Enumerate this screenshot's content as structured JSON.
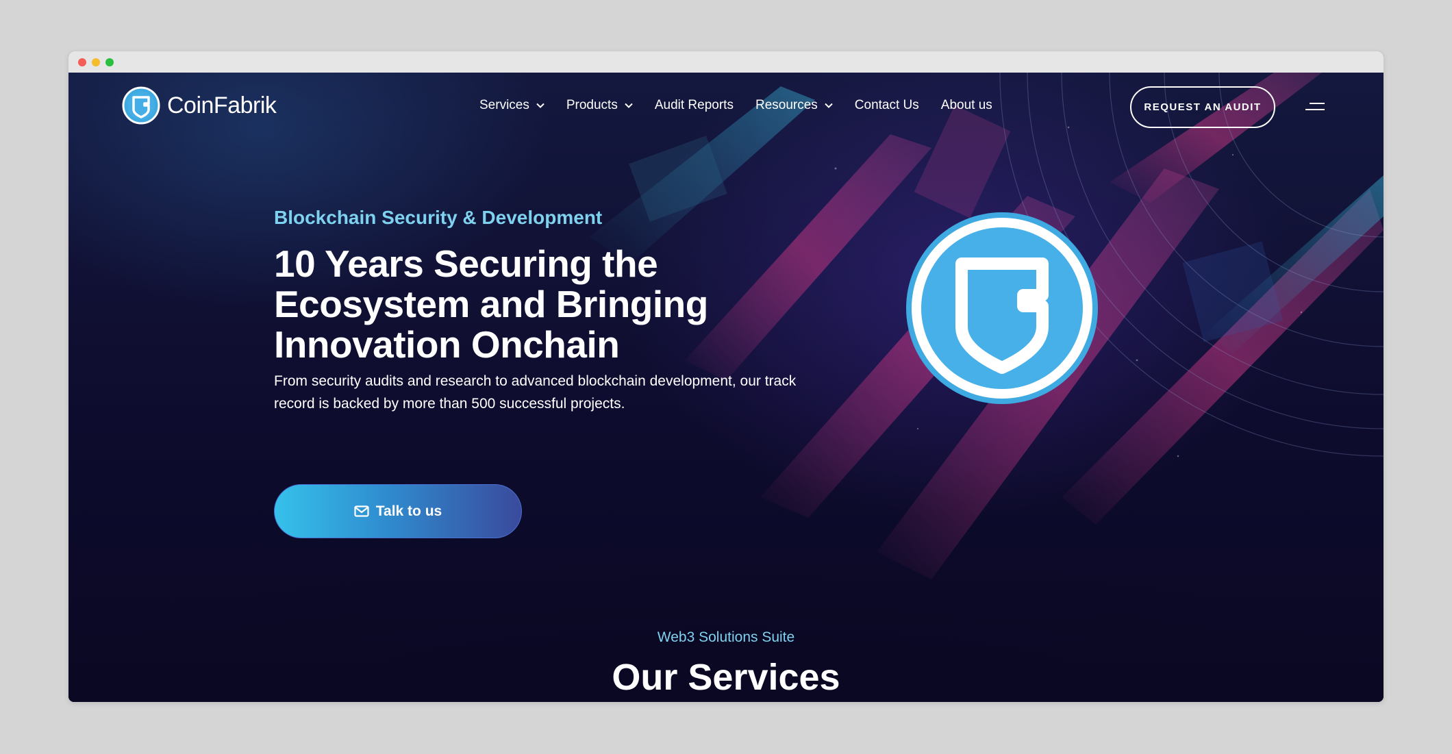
{
  "browser": {
    "title_buttons": [
      "close",
      "minimize",
      "maximize"
    ]
  },
  "header": {
    "logo_text": "CoinFabrik",
    "logo_icon": "shield-logo-icon",
    "nav": [
      {
        "label": "Services",
        "has_dropdown": true
      },
      {
        "label": "Products",
        "has_dropdown": true
      },
      {
        "label": "Audit Reports",
        "has_dropdown": false
      },
      {
        "label": "Resources",
        "has_dropdown": true
      },
      {
        "label": "Contact Us",
        "has_dropdown": false
      },
      {
        "label": "About us",
        "has_dropdown": false
      }
    ],
    "cta_label": "REQUEST AN AUDIT",
    "menu_icon": "hamburger-menu-icon"
  },
  "hero": {
    "eyebrow": "Blockchain Security & Development",
    "title_lines": [
      "10 Years Securing the",
      "Ecosystem and Bringing",
      "Innovation Onchain"
    ],
    "subtitle": "From security audits and research to advanced blockchain development, our track record is backed by more than 500 successful projects.",
    "button_label": "Talk to us",
    "button_icon": "envelope-icon",
    "badge_icon": "shield-logo-icon"
  },
  "services": {
    "eyebrow": "Web3 Solutions Suite",
    "title": "Our Services"
  },
  "colors": {
    "accent_cyan": "#7fd2ef",
    "background": "#0b0a24",
    "button_gradient_start": "#36c1ea",
    "button_gradient_end": "#3a4a9c",
    "badge_blue": "#3fa9e2"
  }
}
